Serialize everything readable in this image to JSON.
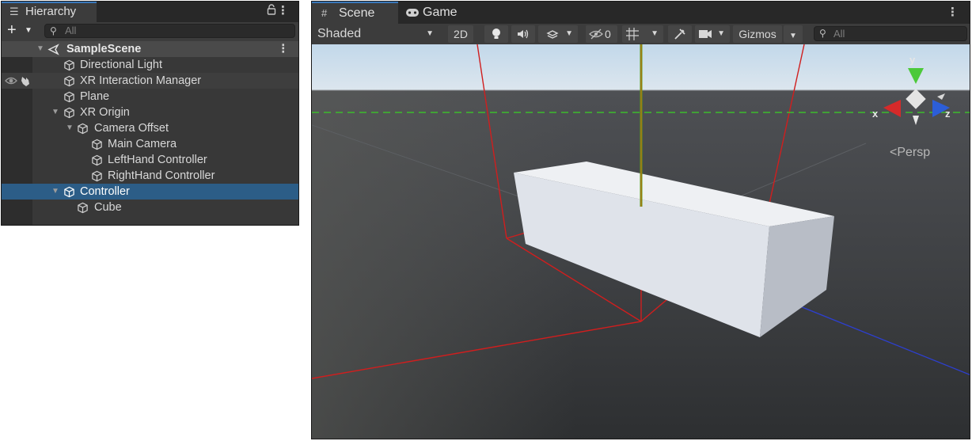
{
  "hierarchy": {
    "tab_label": "Hierarchy",
    "add_label": "+",
    "search_placeholder": "All",
    "rows": [
      {
        "name": "SampleScene"
      },
      {
        "name": "Directional Light"
      },
      {
        "name": "XR Interaction Manager"
      },
      {
        "name": "Plane"
      },
      {
        "name": "XR Origin"
      },
      {
        "name": "Camera Offset"
      },
      {
        "name": "Main Camera"
      },
      {
        "name": "LeftHand Controller"
      },
      {
        "name": "RightHand Controller"
      },
      {
        "name": "Controller",
        "selected": true
      },
      {
        "name": "Cube"
      }
    ]
  },
  "scene": {
    "tabs": [
      {
        "label": "Scene"
      },
      {
        "label": "Game"
      }
    ],
    "toolbar": {
      "draw_mode": "Shaded",
      "mode_2d": "2D",
      "hidden_count": "0",
      "gizmos": "Gizmos",
      "search_placeholder": "All"
    },
    "projection": "Persp",
    "axes": {
      "x": "x",
      "y": "y",
      "z": "z"
    }
  },
  "colors": {
    "selection": "#2c5d87",
    "accent_tab": "#3a79bb",
    "axis_x": "#d93030",
    "axis_y": "#3cbc2c",
    "axis_z": "#2c5ed8"
  }
}
